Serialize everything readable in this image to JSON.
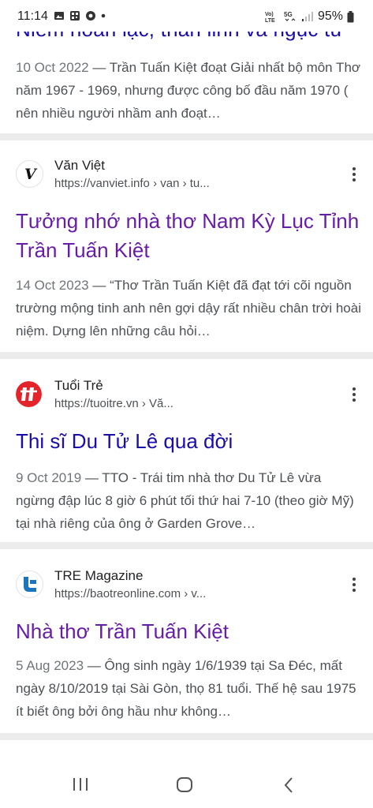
{
  "status": {
    "time": "11:14",
    "battery": "95%",
    "network": "5G"
  },
  "top": {
    "title": "Niềm hoan lạc, thần linh và ngục tù",
    "date": "10 Oct 2022",
    "snippet_body": " — Trần Tuấn Kiệt đoạt Giải nhất bộ môn Thơ năm 1967 - 1969, nhưng được công bố đầu năm 1970 ( nên nhiều người nhầm anh đoạt…"
  },
  "results": [
    {
      "site": "Văn Việt",
      "url": "https://vanviet.info › van › tu...",
      "title": "Tưởng nhớ nhà thơ Nam Kỳ Lục Tỉnh Trần Tuấn Kiệt",
      "date": "14 Oct 2023",
      "snippet_body": " — “Thơ Trần Tuấn Kiệt đã đạt tới cõi nguồn trường mộng tinh anh nên gợi dậy rất nhiều chân trời hoài niệm. Dựng lên những câu hỏi…"
    },
    {
      "site": "Tuổi Trẻ",
      "url": "https://tuoitre.vn › Vă...",
      "title": "Thi sĩ Du Tử Lê qua đời",
      "date": "9 Oct 2019",
      "snippet_body": " — TTO - Trái tim nhà thơ Du Tử Lê vừa ngừng đập lúc 8 giờ 6 phút tối thứ hai 7-10 (theo giờ Mỹ) tại nhà riêng của ông ở Garden Grove…"
    },
    {
      "site": "TRE Magazine",
      "url": "https://baotreonline.com › v...",
      "title": "Nhà thơ Trần Tuấn Kiệt",
      "date": "5 Aug 2023",
      "snippet_body": " — Ông sinh ngày 1/6/1939 tại Sa Đéc, mất ngày 8/10/2019 tại Sài Gòn, thọ 81 tuổi. Thế hệ sau 1975 ít biết ông bởi ông hầu như không…"
    }
  ],
  "colors": {
    "link": "#1a0dab",
    "visited": "#681da8",
    "separator": "#ececec"
  },
  "icons": [
    "image-icon",
    "qr-icon",
    "chrome-icon",
    "dot-icon",
    "volte-icon",
    "5g-icon",
    "signal-icon",
    "battery-icon",
    "recent-apps-icon",
    "home-icon",
    "back-icon"
  ]
}
